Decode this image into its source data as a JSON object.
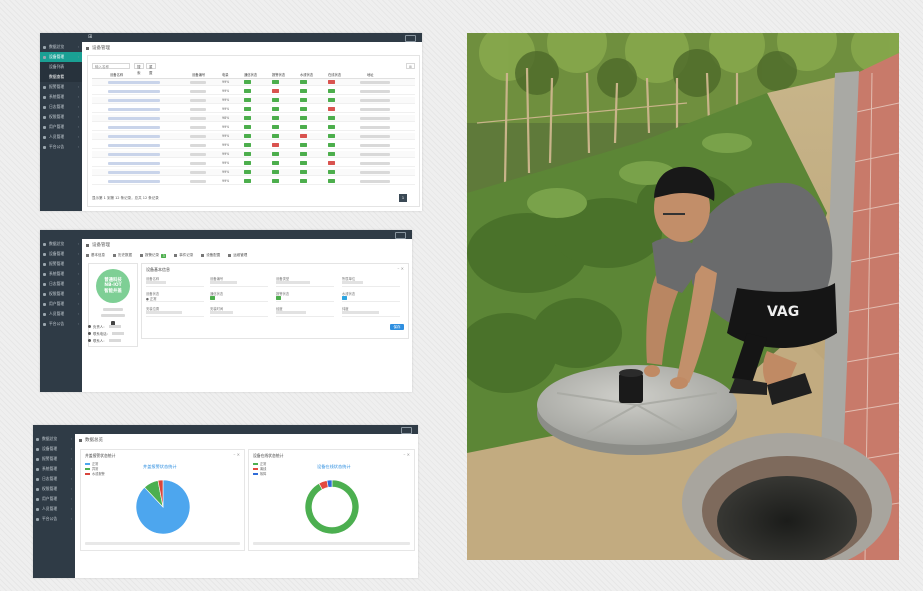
{
  "shot_list": {
    "brand": "⊞",
    "breadcrumb": "设备管理",
    "sidebar": [
      {
        "label": "数据总览",
        "state": "normal"
      },
      {
        "label": "设备管理",
        "state": "active"
      },
      {
        "label": "设备列表",
        "state": "sub"
      },
      {
        "label": "数据查看",
        "state": "sub-current"
      },
      {
        "label": "报警管理",
        "state": "normal"
      },
      {
        "label": "系统管理",
        "state": "normal"
      },
      {
        "label": "日志管理",
        "state": "normal"
      },
      {
        "label": "权限管理",
        "state": "normal"
      },
      {
        "label": "用户管理",
        "state": "normal"
      },
      {
        "label": "人员管理",
        "state": "normal"
      },
      {
        "label": "平台公告",
        "state": "normal"
      }
    ],
    "search": {
      "placeholder": "输入名称",
      "btn_search": "搜索",
      "btn_reset": "重置"
    },
    "columns": [
      "设备名称",
      "设备编号",
      "电量",
      "通信状态",
      "报警状态",
      "水浸状态",
      "在线状态",
      "地址"
    ],
    "rows": [
      {
        "battery": "99%",
        "s": [
          "g",
          "g",
          "g",
          "r"
        ]
      },
      {
        "battery": "99%",
        "s": [
          "g",
          "r",
          "g",
          "g"
        ]
      },
      {
        "battery": "99%",
        "s": [
          "g",
          "g",
          "g",
          "g"
        ]
      },
      {
        "battery": "99%",
        "s": [
          "g",
          "g",
          "g",
          "r"
        ]
      },
      {
        "battery": "98%",
        "s": [
          "g",
          "g",
          "g",
          "g"
        ]
      },
      {
        "battery": "99%",
        "s": [
          "g",
          "g",
          "g",
          "g"
        ]
      },
      {
        "battery": "99%",
        "s": [
          "g",
          "g",
          "r",
          "g"
        ]
      },
      {
        "battery": "99%",
        "s": [
          "g",
          "r",
          "g",
          "g"
        ]
      },
      {
        "battery": "99%",
        "s": [
          "g",
          "g",
          "g",
          "g"
        ]
      },
      {
        "battery": "99%",
        "s": [
          "g",
          "g",
          "g",
          "r"
        ]
      },
      {
        "battery": "99%",
        "s": [
          "g",
          "g",
          "g",
          "g"
        ]
      },
      {
        "battery": "99%",
        "s": [
          "g",
          "g",
          "g",
          "g"
        ]
      }
    ],
    "pager_text": "显示第 1 到第 12 条记录，总共 12 条记录",
    "page": "1"
  },
  "shot_detail": {
    "breadcrumb": "设备管理",
    "sidebar": [
      "数据总览",
      "设备管理",
      "报警管理",
      "系统管理",
      "日志管理",
      "权限管理",
      "用户管理",
      "人员管理",
      "平台公告"
    ],
    "tabs": [
      {
        "label": "基本信息",
        "count": ""
      },
      {
        "label": "历史数据",
        "count": ""
      },
      {
        "label": "报警记录",
        "count": "3"
      },
      {
        "label": "事件记录",
        "count": ""
      },
      {
        "label": "设备配置",
        "count": ""
      },
      {
        "label": "运维管理",
        "count": ""
      }
    ],
    "logo_lines": [
      "普通科技",
      "NB-IOT",
      "智能井盖"
    ],
    "contacts": [
      "负责人：",
      "联系电话：",
      "联系人："
    ],
    "panel_title": "设备基本信息",
    "field_labels": [
      "设备名称",
      "设备编号",
      "设备类型",
      "所属单位",
      "设备状态",
      "通信状态",
      "报警状态",
      "水浸状态",
      "安装位置",
      "安装时间",
      "经度",
      "纬度"
    ],
    "status_text": "● 正常",
    "btn_save": "保存"
  },
  "shot_charts": {
    "breadcrumb": "数据总览",
    "sidebar": [
      "数据总览",
      "设备管理",
      "报警管理",
      "系统管理",
      "日志管理",
      "权限管理",
      "用户管理",
      "人员管理",
      "平台公告"
    ],
    "card1_title": "井盖报警状态统计",
    "card2_title": "设备在线状态统计",
    "card_tools": "– ✕"
  },
  "chart_data": [
    {
      "type": "pie",
      "title": "井盖报警状态统计",
      "categories": [
        "正常",
        "异常",
        "水浸报警"
      ],
      "values": [
        88,
        9,
        3
      ],
      "colors": [
        "#4da6ee",
        "#4caf50",
        "#d9453c"
      ]
    },
    {
      "type": "pie",
      "title": "设备在线状态统计",
      "categories": [
        "正常",
        "离线",
        "故障"
      ],
      "values": [
        92,
        5,
        3
      ],
      "colors": [
        "#4caf50",
        "#e34a3f",
        "#2f6bd8"
      ]
    }
  ],
  "photo": {
    "shirt_text": "VAG"
  }
}
